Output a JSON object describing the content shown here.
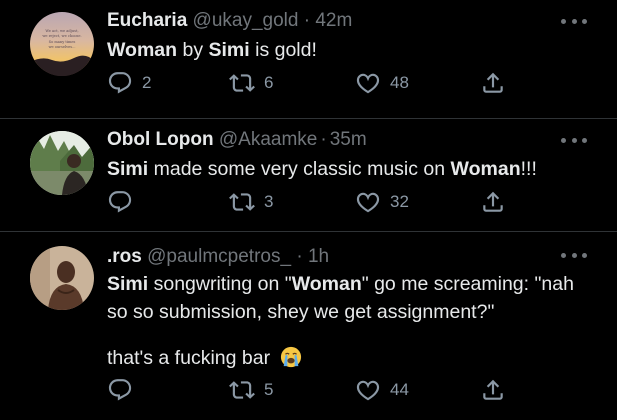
{
  "tweets": [
    {
      "name": "Eucharia",
      "handle": "@ukay_gold",
      "separator": "·",
      "time": "42m",
      "text": [
        {
          "t": "Woman",
          "b": true
        },
        {
          "t": " by ",
          "b": false
        },
        {
          "t": "Simi",
          "b": true
        },
        {
          "t": " is gold!",
          "b": false
        }
      ],
      "avatar_text": [
        "We act, we adjust,",
        "we reject, we choose.",
        "So many times",
        "we ourselves..."
      ],
      "replies": "2",
      "retweets": "6",
      "likes": "48"
    },
    {
      "name": "Obol Lopon",
      "handle": "@Akaamke",
      "separator": "·",
      "time": "35m",
      "text": [
        {
          "t": "Simi",
          "b": true
        },
        {
          "t": " made some very classic music on ",
          "b": false
        },
        {
          "t": "Woman",
          "b": true
        },
        {
          "t": "!!!",
          "b": false
        }
      ],
      "replies": "",
      "retweets": "3",
      "likes": "32"
    },
    {
      "name": ".ros",
      "handle": "@paulmcpetros_",
      "separator": "·",
      "time": "1h",
      "text_line1": [
        {
          "t": "Simi",
          "b": true
        },
        {
          "t": " songwriting on \"",
          "b": false
        },
        {
          "t": "Woman",
          "b": true
        },
        {
          "t": "\" go me screaming: \"nah",
          "b": false
        }
      ],
      "text_line2": "so so submission, shey we get assignment?\"",
      "text_line3": "that's a fucking bar",
      "replies": "",
      "retweets": "5",
      "likes": "44"
    }
  ],
  "icons": {
    "reply": "reply-icon",
    "retweet": "retweet-icon",
    "like": "like-icon",
    "share": "share-icon",
    "more": "more-icon",
    "emoji": "loudly-crying-face-icon"
  },
  "colors": {
    "background": "#000000",
    "text": "#e7e9ea",
    "muted": "#71767b",
    "icon": "#8b98a5",
    "divider": "#2f3336"
  }
}
